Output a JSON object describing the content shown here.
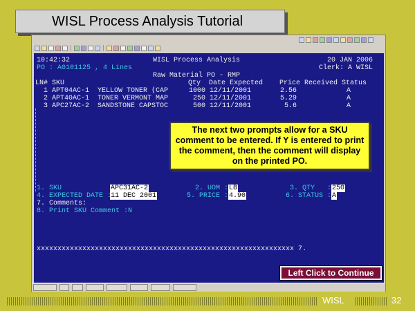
{
  "slide": {
    "title": "WISL Process Analysis Tutorial",
    "footer_label": "WISL",
    "page_number": "32",
    "continue_label": "Left Click to Continue",
    "callout": "The next two prompts allow for a SKU comment to be entered. If Y is entered to print the comment, then the comment will display on the printed PO."
  },
  "terminal": {
    "time": "10:42:32",
    "app_title": "WISL Process Analysis",
    "date": "20 JAN 2006",
    "po_line": "PO : A0101125 , 4 Lines",
    "clerk": "Clerk: A WISL",
    "section": "Raw Material PO - RMP",
    "header_left": "LN# SKU",
    "header_right": "Qty  Date Expected    Price Received Status",
    "rows": [
      {
        "ln": "1",
        "sku": "APT04AC-1",
        "desc": "YELLOW TONER (CAP",
        "qty": "1000",
        "date": "12/11/2001",
        "price": "2.56",
        "status": "A"
      },
      {
        "ln": "2",
        "sku": "APT40AC-1",
        "desc": "TONER VERMONT MAP",
        "qty": "250",
        "date": "12/11/2001",
        "price": "5.29",
        "status": "A"
      },
      {
        "ln": "3",
        "sku": "APC27AC-2",
        "desc": "SANDSTONE CAPSTOC",
        "qty": "500",
        "date": "12/11/2001",
        "price": "5.6",
        "status": "A"
      }
    ],
    "form": {
      "sku_label": "1. SKU",
      "sku_value": "APC31AC-2",
      "uom_label": "2. UOM :",
      "uom_value": "LB",
      "qty_label": "3. QTY   :",
      "qty_value": "250",
      "exp_label": "4. EXPECTED DATE :",
      "exp_value": "11 DEC 2001",
      "price_label": "5. PRICE :",
      "price_value": "4.90",
      "status_label": "6. STATUS :",
      "status_value": "A",
      "comments_label": "7. Comments:",
      "print_label": "8. Print SKU Comment :N"
    },
    "input_line": "xxxxxxxxxxxxxxxxxxxxxxxxxxxxxxxxxxxxxxxxxxxxxxxxxxxxxxxxxxxxxx 7."
  }
}
